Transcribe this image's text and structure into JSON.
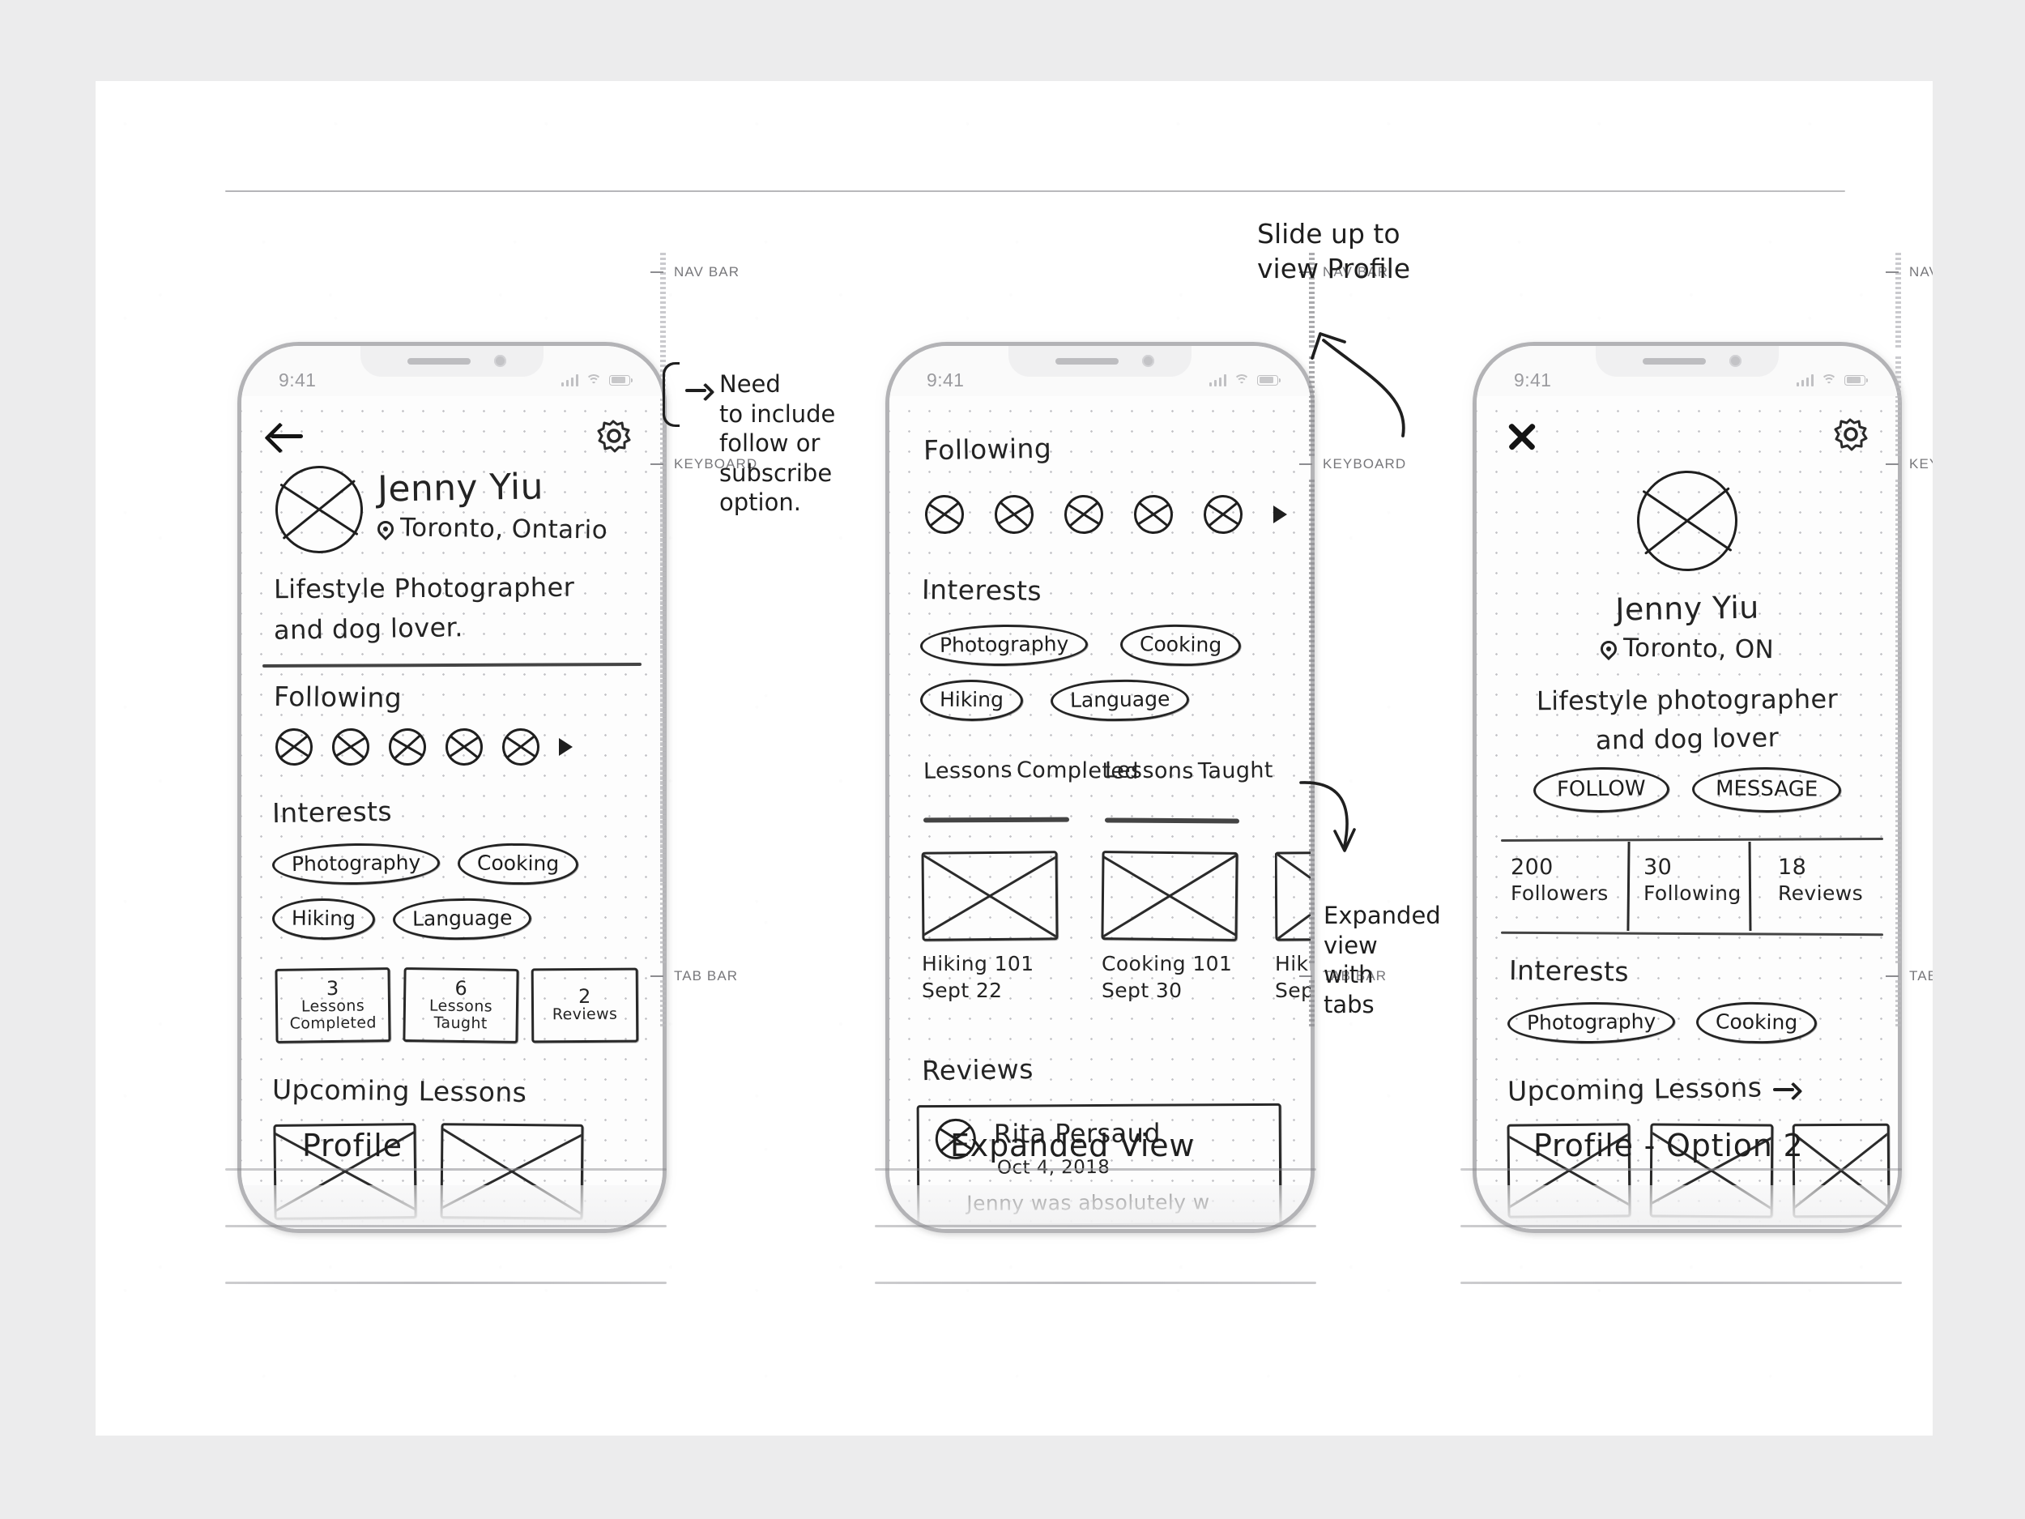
{
  "document": {
    "type": "hand-drawn-wireframe-sketch",
    "status_bar": {
      "time": "9:41",
      "icons": [
        "signal-bars-icon",
        "wifi-icon",
        "battery-icon"
      ]
    },
    "guide_labels": {
      "nav_bar": "NAV BAR",
      "keyboard": "KEYBOARD",
      "tab_bar": "TAB BAR"
    }
  },
  "screen1": {
    "caption": "Profile",
    "nav": {
      "back_icon": "back-arrow-icon",
      "settings_icon": "gear-icon"
    },
    "profile": {
      "avatar": "avatar-placeholder",
      "name": "Jenny Yiu",
      "location_icon": "location-pin-icon",
      "location": "Toronto, Ontario",
      "bio_line1": "Lifestyle Photographer",
      "bio_line2": "and dog lover."
    },
    "following": {
      "heading": "Following",
      "avatar_count": 5,
      "chevron_icon": "chevron-right-icon"
    },
    "interests": {
      "heading": "Interests",
      "tags": [
        "Photography",
        "Cooking",
        "Hiking",
        "Language"
      ]
    },
    "stats": [
      {
        "value": "3",
        "label_line1": "Lessons",
        "label_line2": "Completed"
      },
      {
        "value": "6",
        "label_line1": "Lessons",
        "label_line2": "Taught"
      },
      {
        "value": "2",
        "label_line1": "Reviews",
        "label_line2": ""
      }
    ],
    "upcoming": {
      "heading": "Upcoming Lessons",
      "card_count": 2
    }
  },
  "screen2": {
    "caption": "Expanded View",
    "following": {
      "heading": "Following",
      "avatar_count": 5,
      "chevron_icon": "chevron-right-icon"
    },
    "interests": {
      "heading": "Interests",
      "tags": [
        "Photography",
        "Cooking",
        "Hiking",
        "Language"
      ]
    },
    "lesson_tabs": [
      {
        "line1": "Lessons",
        "line2": "Completed",
        "active": true
      },
      {
        "line1": "Lessons",
        "line2": "Taught",
        "active": true
      }
    ],
    "lesson_cards": [
      {
        "title": "Hiking 101",
        "date": "Sept 22"
      },
      {
        "title": "Cooking 101",
        "date": "Sept 30"
      },
      {
        "title": "Hiki",
        "date": "Sept"
      }
    ],
    "reviews": {
      "heading": "Reviews",
      "items": [
        {
          "avatar": "reviewer-avatar",
          "name": "Rita Persaud",
          "date": "Oct 4, 2018",
          "body": "Jenny was absolutely w"
        }
      ]
    }
  },
  "screen3": {
    "caption": "Profile - Option 2",
    "nav": {
      "close_icon": "x-close-icon",
      "settings_icon": "gear-icon"
    },
    "profile": {
      "avatar": "avatar-placeholder",
      "name": "Jenny Yiu",
      "location_icon": "location-pin-icon",
      "location": "Toronto, ON",
      "bio_line1": "Lifestyle photographer",
      "bio_line2": "and dog lover"
    },
    "actions": [
      {
        "label": "FOLLOW"
      },
      {
        "label": "MESSAGE"
      }
    ],
    "stats": [
      {
        "value": "200",
        "label": "Followers"
      },
      {
        "value": "30",
        "label": "Following"
      },
      {
        "value": "18",
        "label": "Reviews"
      }
    ],
    "interests": {
      "heading": "Interests",
      "tags": [
        "Photography",
        "Cooking"
      ]
    },
    "upcoming": {
      "heading": "Upcoming Lessons",
      "arrow_icon": "arrow-right-icon",
      "card_count": 3
    }
  },
  "annotations": [
    {
      "id": "note-follow-subscribe",
      "text": "Need\nto include\nfollow or\nsubscribe\noption.",
      "marker": "curly-brace-with-arrow"
    },
    {
      "id": "note-expanded-view",
      "text": "Expanded\nview\nwith\ntabs",
      "marker": "curved-arrow-up"
    },
    {
      "id": "note-slide-up",
      "text": "Slide up to\nview Profile",
      "marker": "curved-arrow-up"
    }
  ],
  "colors": {
    "paper": "#ffffff",
    "page_background": "#ececed",
    "ink": "#1f1f1f",
    "guide_text": "#77777b",
    "device_frame": "#b3b3b6",
    "grid_dot": "#c2c2c6"
  }
}
